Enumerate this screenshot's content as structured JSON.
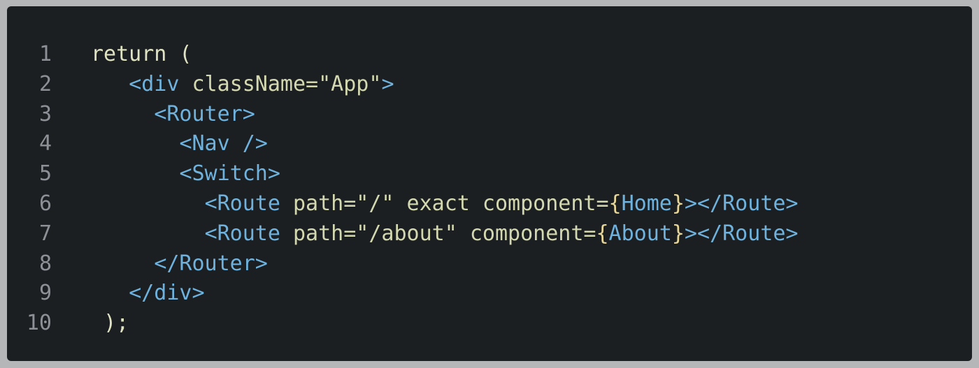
{
  "editor": {
    "theme_colors": {
      "background": "#1c1f22",
      "outer_background": "#b4b6b8",
      "line_number": "#8d9096",
      "plain": "#dfe3c2",
      "tag": "#6eb2dd",
      "attribute": "#d3d8b0",
      "brace": "#e7d69a"
    },
    "lines": [
      {
        "number": "1",
        "indent": "",
        "tokens": [
          {
            "text": "return (",
            "kind": "plain"
          }
        ]
      },
      {
        "number": "2",
        "indent": "   ",
        "tokens": [
          {
            "text": "<div ",
            "kind": "tag"
          },
          {
            "text": "className=\"App\"",
            "kind": "attr"
          },
          {
            "text": ">",
            "kind": "tag"
          }
        ]
      },
      {
        "number": "3",
        "indent": "     ",
        "tokens": [
          {
            "text": "<Router>",
            "kind": "tag"
          }
        ]
      },
      {
        "number": "4",
        "indent": "       ",
        "tokens": [
          {
            "text": "<Nav />",
            "kind": "tag"
          }
        ]
      },
      {
        "number": "5",
        "indent": "       ",
        "tokens": [
          {
            "text": "<Switch>",
            "kind": "tag"
          }
        ]
      },
      {
        "number": "6",
        "indent": "         ",
        "tokens": [
          {
            "text": "<Route ",
            "kind": "tag"
          },
          {
            "text": "path=\"/\" exact component=",
            "kind": "attr"
          },
          {
            "text": "{",
            "kind": "brace"
          },
          {
            "text": "Home",
            "kind": "comp"
          },
          {
            "text": "}",
            "kind": "brace"
          },
          {
            "text": "></Route>",
            "kind": "tag"
          }
        ]
      },
      {
        "number": "7",
        "indent": "         ",
        "tokens": [
          {
            "text": "<Route ",
            "kind": "tag"
          },
          {
            "text": "path=\"/about\" component=",
            "kind": "attr"
          },
          {
            "text": "{",
            "kind": "brace"
          },
          {
            "text": "About",
            "kind": "comp"
          },
          {
            "text": "}",
            "kind": "brace"
          },
          {
            "text": "></Route>",
            "kind": "tag"
          }
        ]
      },
      {
        "number": "8",
        "indent": "     ",
        "tokens": [
          {
            "text": "</Router>",
            "kind": "tag"
          }
        ]
      },
      {
        "number": "9",
        "indent": "   ",
        "tokens": [
          {
            "text": "</div>",
            "kind": "tag"
          }
        ]
      },
      {
        "number": "10",
        "indent": " ",
        "tokens": [
          {
            "text": ");",
            "kind": "plain"
          }
        ]
      }
    ]
  }
}
